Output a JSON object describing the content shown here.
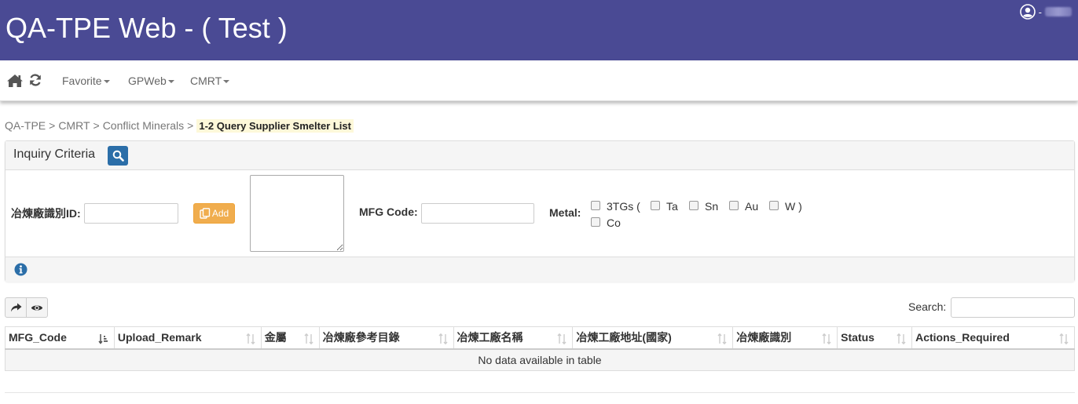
{
  "header": {
    "title": "QA-TPE Web - ( Test )",
    "user_prefix": "-"
  },
  "nav": {
    "home_icon": "home-icon",
    "refresh_icon": "refresh-icon",
    "menus": [
      "Favorite",
      "GPWeb",
      "CMRT"
    ]
  },
  "breadcrumb": {
    "items": [
      "QA-TPE",
      "CMRT",
      "Conflict Minerals"
    ],
    "separator": ">",
    "current": "1-2 Query Supplier Smelter List"
  },
  "criteria": {
    "title": "Inquiry Criteria",
    "smelter_id_label": "冶煉廠識別ID:",
    "smelter_id_value": "",
    "add_label": "Add",
    "mfg_code_label": "MFG Code:",
    "mfg_code_value": "",
    "metal_label": "Metal:",
    "metals": {
      "tg_label": "3TGs (",
      "ta": "Ta",
      "sn": "Sn",
      "au": "Au",
      "w": "W )",
      "co": "Co"
    }
  },
  "toolbar": {
    "search_label": "Search:",
    "search_value": ""
  },
  "table": {
    "columns": [
      "MFG_Code",
      "Upload_Remark",
      "金屬",
      "冶煉廠參考目錄",
      "冶煉工廠名稱",
      "冶煉工廠地址(國家)",
      "冶煉廠識別",
      "Status",
      "Actions_Required"
    ],
    "empty_message": "No data available in table"
  },
  "colors": {
    "header_bg": "#4a4a94",
    "primary_button": "#2b6ea8",
    "add_button": "#f0ad4e",
    "highlight": "#fdf8d9"
  }
}
